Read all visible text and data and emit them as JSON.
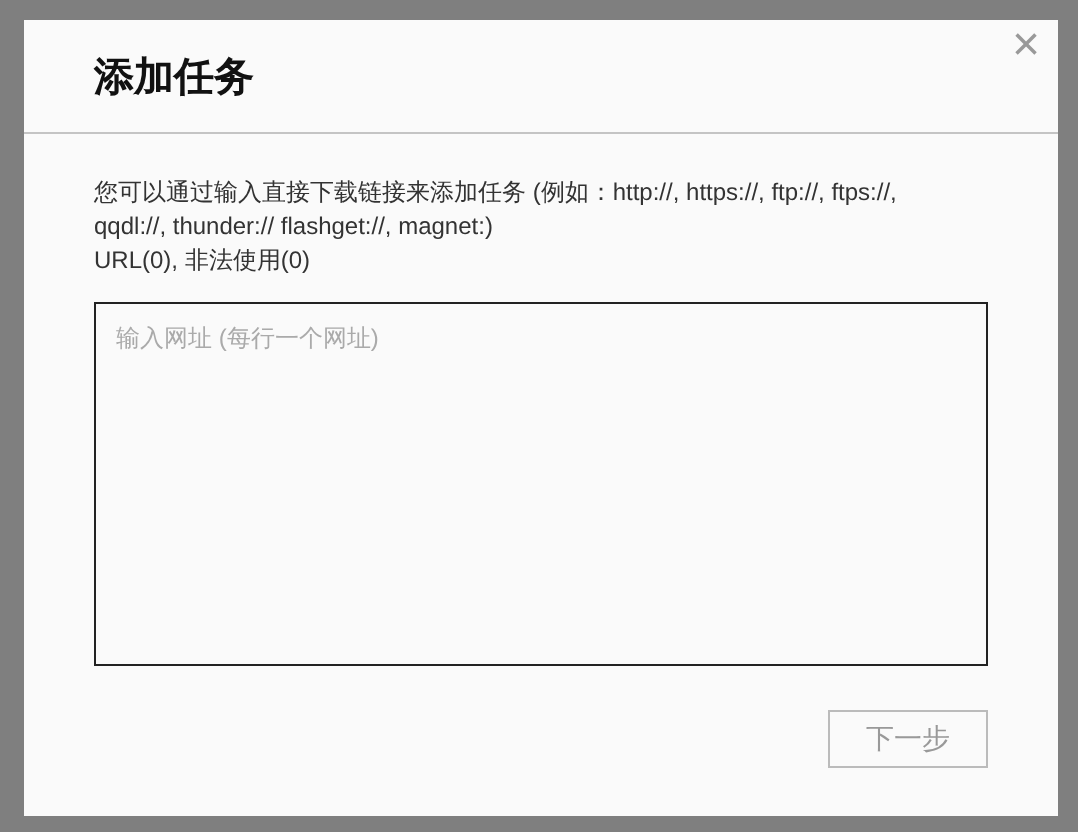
{
  "dialog": {
    "title": "添加任务",
    "close": "×",
    "description": "您可以通过输入直接下载链接来添加任务 (例如：http://, https://, ftp://, ftps://, qqdl://, thunder:// flashget://, magnet:)",
    "counts": "URL(0), 非法使用(0)",
    "url_field": {
      "placeholder": "输入网址 (每行一个网址)"
    },
    "next_button": {
      "label": "下一步",
      "disabled": true
    }
  }
}
